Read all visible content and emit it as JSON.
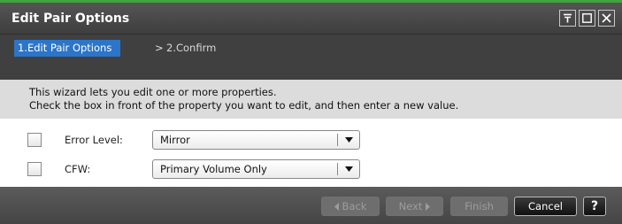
{
  "dialog": {
    "title": "Edit Pair Options",
    "window_buttons": [
      {
        "name": "pin-icon"
      },
      {
        "name": "maximize-icon"
      },
      {
        "name": "close-icon"
      }
    ]
  },
  "steps": {
    "active": "1.Edit Pair Options",
    "separator": ">",
    "next": "2.Confirm"
  },
  "description": {
    "line1": "This wizard lets you edit one or more properties.",
    "line2": "Check the box in front of the property you want to edit, and then enter a new value."
  },
  "fields": [
    {
      "label": "Error Level:",
      "value": "Mirror",
      "checked": false
    },
    {
      "label": "CFW:",
      "value": "Primary Volume Only",
      "checked": false
    }
  ],
  "footer": {
    "back": "Back",
    "next": "Next",
    "finish": "Finish",
    "cancel": "Cancel",
    "help": "?"
  },
  "colors": {
    "accent_bar": "#3da63d",
    "active_step": "#2c75c9",
    "titlebar": "#474747"
  }
}
